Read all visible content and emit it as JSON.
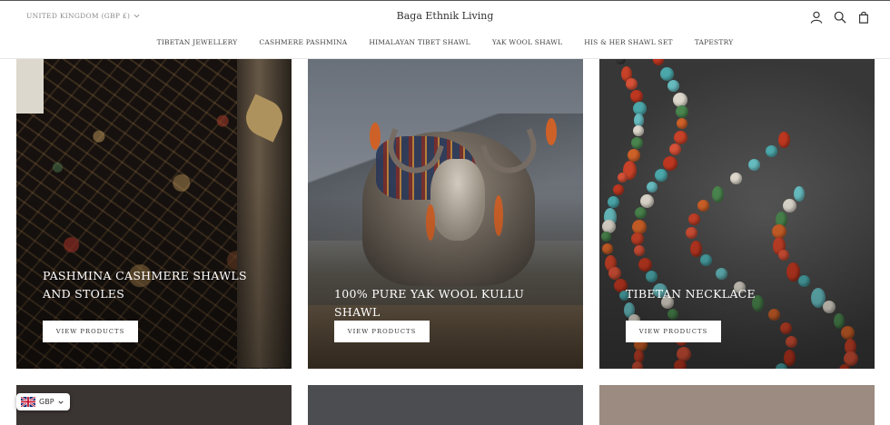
{
  "header": {
    "currency_selector": "UNITED KINGDOM (GBP £)",
    "brand": "Baga Ethnik Living",
    "icons": [
      "account-icon",
      "search-icon",
      "cart-icon"
    ]
  },
  "nav": {
    "items": [
      {
        "label": "TIBETAN JEWELLERY"
      },
      {
        "label": "CASHMERE PASHMINA"
      },
      {
        "label": "HIMALAYAN TIBET SHAWL"
      },
      {
        "label": "YAK WOOL SHAWL"
      },
      {
        "label": "HIS & HER SHAWL SET"
      },
      {
        "label": "TAPESTRY"
      }
    ]
  },
  "collections": [
    {
      "title": "PASHMINA CASHMERE SHAWLS AND STOLES",
      "button": "VIEW PRODUCTS"
    },
    {
      "title": "100% PURE YAK WOOL KULLU SHAWL",
      "button": "VIEW PRODUCTS"
    },
    {
      "title": "TIBETAN NECKLACE",
      "button": "VIEW PRODUCTS"
    }
  ],
  "currency_widget": {
    "code": "GBP",
    "flag": "uk-flag-icon"
  },
  "colors": {
    "accent_text": "#ffffff",
    "header_border": "#e6e6e6",
    "button_bg": "#ffffff"
  }
}
